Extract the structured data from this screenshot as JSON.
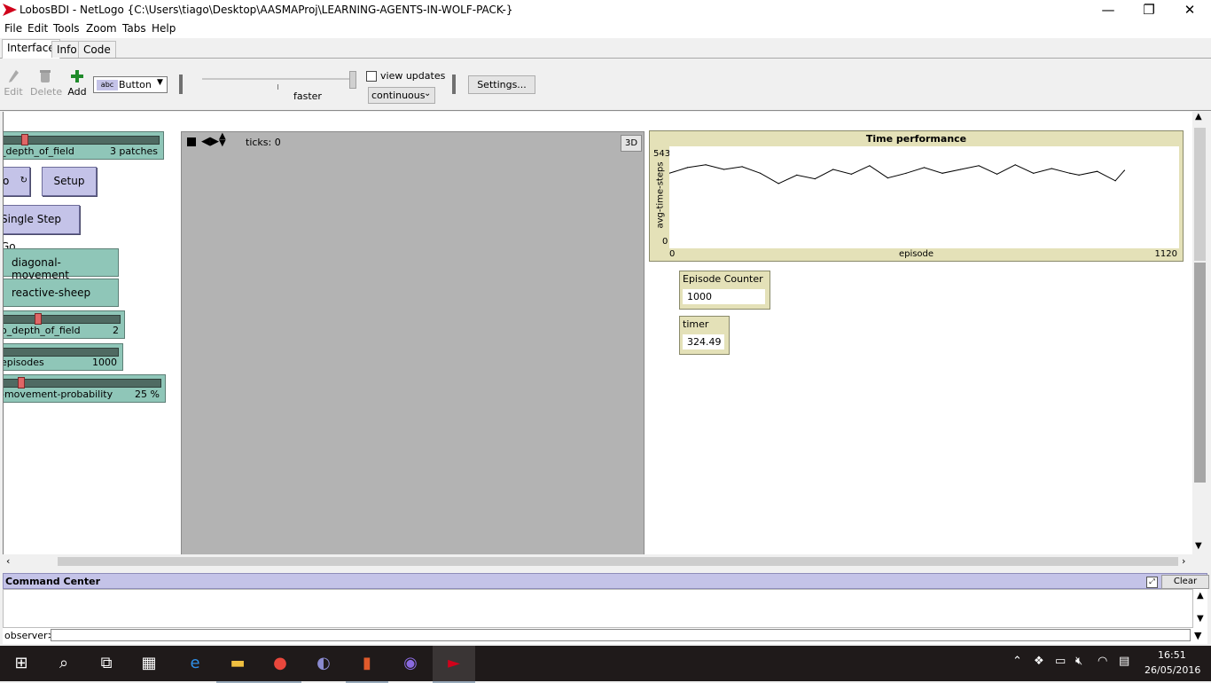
{
  "window": {
    "title": "LobosBDI - NetLogo {C:\\Users\\tiago\\Desktop\\AASMAProj\\LEARNING-AGENTS-IN-WOLF-PACK-}",
    "minimize": "—",
    "maximize": "❐",
    "close": "✕"
  },
  "menu": [
    "File",
    "Edit",
    "Tools",
    "Zoom",
    "Tabs",
    "Help"
  ],
  "tabs": [
    "Interface",
    "Info",
    "Code"
  ],
  "toolbar": {
    "edit": "Edit",
    "delete": "Delete",
    "add": "Add",
    "widget_type": "Button",
    "widget_icon_text": "abc",
    "speed_label": "faster",
    "view_updates": "view updates",
    "update_mode": "continuous",
    "settings": "Settings..."
  },
  "widgets": {
    "slider1": {
      "label": "_depth_of_field",
      "value": "3 patches",
      "level": 0.12
    },
    "go_button": "o",
    "setup_button": "Setup",
    "single_step_button": "Single Step Go",
    "switch1": "diagonal-movement",
    "switch2": "reactive-sheep",
    "slider2": {
      "label": "o_depth_of_field",
      "value": "2",
      "level": 0.28
    },
    "slider3": {
      "label": "episodes",
      "value": "1000",
      "level": 1.0
    },
    "slider4": {
      "label": "-movement-probability",
      "value": "25 %",
      "level": 0.1
    }
  },
  "view": {
    "ticks": "ticks: 0",
    "three_d": "3D"
  },
  "plot": {
    "title": "Time performance",
    "ylabel": "avg-time-steps",
    "xlabel": "episode",
    "xmin": "0",
    "xmax": "1120",
    "ymin": "0",
    "ymax": "543"
  },
  "chart_data": {
    "type": "line",
    "title": "Time performance",
    "xlabel": "episode",
    "ylabel": "avg-time-steps",
    "xlim": [
      0,
      1120
    ],
    "ylim": [
      0,
      543
    ],
    "x": [
      0,
      40,
      80,
      120,
      160,
      200,
      240,
      280,
      320,
      360,
      400,
      440,
      480,
      520,
      560,
      600,
      640,
      680,
      720,
      760,
      800,
      840,
      880,
      900,
      940,
      980,
      1000
    ],
    "y": [
      400,
      430,
      445,
      420,
      435,
      400,
      345,
      390,
      370,
      420,
      395,
      440,
      375,
      400,
      430,
      400,
      420,
      440,
      395,
      445,
      400,
      425,
      400,
      390,
      410,
      360,
      415
    ]
  },
  "monitors": {
    "episode_counter": {
      "label": "Episode Counter",
      "value": "1000"
    },
    "timer": {
      "label": "timer",
      "value": "324.49"
    }
  },
  "command_center": {
    "title": "Command Center",
    "clear": "Clear",
    "observer": "observer>"
  },
  "taskbar": {
    "time": "16:51",
    "date": "26/05/2016"
  }
}
